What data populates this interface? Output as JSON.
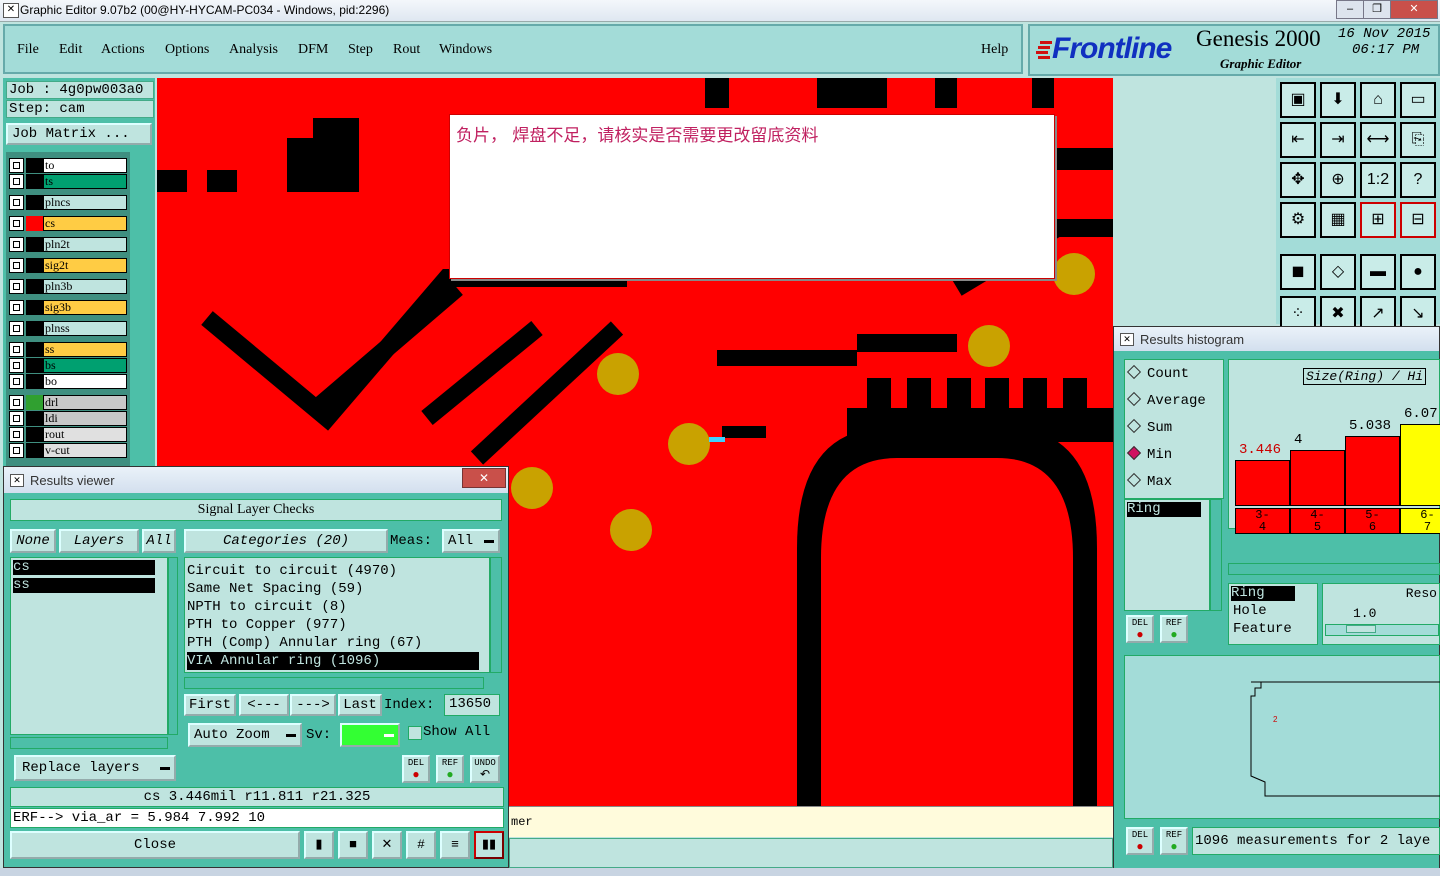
{
  "window": {
    "title": "Graphic Editor 9.07b2 (00@HY-HYCAM-PC034 - Windows, pid:2296)"
  },
  "menu": {
    "items": [
      "File",
      "Edit",
      "Actions",
      "Options",
      "Analysis",
      "DFM",
      "Step",
      "Rout",
      "Windows"
    ],
    "help": "Help"
  },
  "brand": {
    "logo": "Frontline",
    "product": "Genesis 2000",
    "sub": "Graphic Editor",
    "date": "16 Nov 2015",
    "time": "06:17 PM"
  },
  "job": {
    "job": "Job : 4g0pw003a0",
    "step": "Step: cam",
    "matrix": "Job Matrix ..."
  },
  "layers": [
    {
      "name": "to",
      "color": "#ffffff",
      "swatch": "#000000"
    },
    {
      "name": "ts",
      "color": "#00a070",
      "swatch": "#000000"
    },
    {
      "name": "plncs",
      "color": "#bfe4df",
      "swatch": "#000000"
    },
    {
      "name": "cs",
      "color": "#ffcc44",
      "swatch": "#ff0000"
    },
    {
      "name": "pln2t",
      "color": "#bfe4df",
      "swatch": "#000000"
    },
    {
      "name": "sig2t",
      "color": "#ffcc44",
      "swatch": "#000000"
    },
    {
      "name": "pln3b",
      "color": "#bfe4df",
      "swatch": "#000000"
    },
    {
      "name": "sig3b",
      "color": "#ffcc44",
      "swatch": "#000000"
    },
    {
      "name": "plnss",
      "color": "#bfe4df",
      "swatch": "#000000"
    },
    {
      "name": "ss",
      "color": "#ffcc44",
      "swatch": "#000000"
    },
    {
      "name": "bs",
      "color": "#00a070",
      "swatch": "#000000"
    },
    {
      "name": "bo",
      "color": "#ffffff",
      "swatch": "#000000"
    },
    {
      "name": "drl",
      "color": "#c8c8c8",
      "swatch": "#30a030"
    },
    {
      "name": "ldi",
      "color": "#c8c8c8",
      "swatch": "#000000"
    },
    {
      "name": "rout",
      "color": "#e0e0e0",
      "swatch": "#000000"
    },
    {
      "name": "v-cut",
      "color": "#e0e0e0",
      "swatch": "#000000"
    }
  ],
  "message": "负片， 焊盘不足，请核实是否需要更改留底资料",
  "results_viewer": {
    "title": "Results viewer",
    "header": "Signal Layer Checks",
    "none": "None",
    "layers_btn": "Layers",
    "all_btn": "All",
    "categories_btn": "Categories (20)",
    "meas_label": "Meas:",
    "meas_value": "All",
    "layer_list": [
      "cs",
      "ss"
    ],
    "categories": [
      "Circuit to circuit (4970)",
      "Same Net Spacing (59)",
      "NPTH to circuit (8)",
      "PTH to Copper (977)",
      "PTH (Comp) Annular ring (67)",
      "VIA Annular ring (1096)"
    ],
    "first": "First",
    "prev": "<---",
    "next": "--->",
    "last": "Last",
    "index_label": "Index:",
    "index_value": "13650",
    "auto_zoom": "Auto Zoom",
    "sv_label": "Sv:",
    "show_all": "Show All",
    "replace_layers": "Replace layers",
    "del": "DEL",
    "ref": "REF",
    "undo": "UNDO",
    "status": "cs 3.446mil   r11.811   r21.325",
    "erf": "ERF--> via_ar = 5.984 7.992 10",
    "close": "Close"
  },
  "bottom_text": "mer",
  "histogram": {
    "title": "Results histogram",
    "options": [
      "Count",
      "Average",
      "Sum",
      "Min",
      "Max"
    ],
    "selected": "Min",
    "chart_title": "Size(Ring) / Hi",
    "list_selected": "Ring",
    "del": "DEL",
    "ref": "REF",
    "bars": [
      {
        "value": "3.446",
        "range": "3-\n4",
        "color": "#ff0000"
      },
      {
        "value": "4",
        "range": "4-\n5",
        "color": "#ff0000"
      },
      {
        "value": "5.038",
        "range": "5-\n6",
        "color": "#ff0000"
      },
      {
        "value": "6.07",
        "range": "6-\n7",
        "color": "#ffff00"
      }
    ],
    "fields": [
      "Ring",
      "Hole",
      "Feature"
    ],
    "reso_label": "Reso",
    "reso_value": "1.0",
    "measurements": "1096 measurements for 2 laye"
  }
}
